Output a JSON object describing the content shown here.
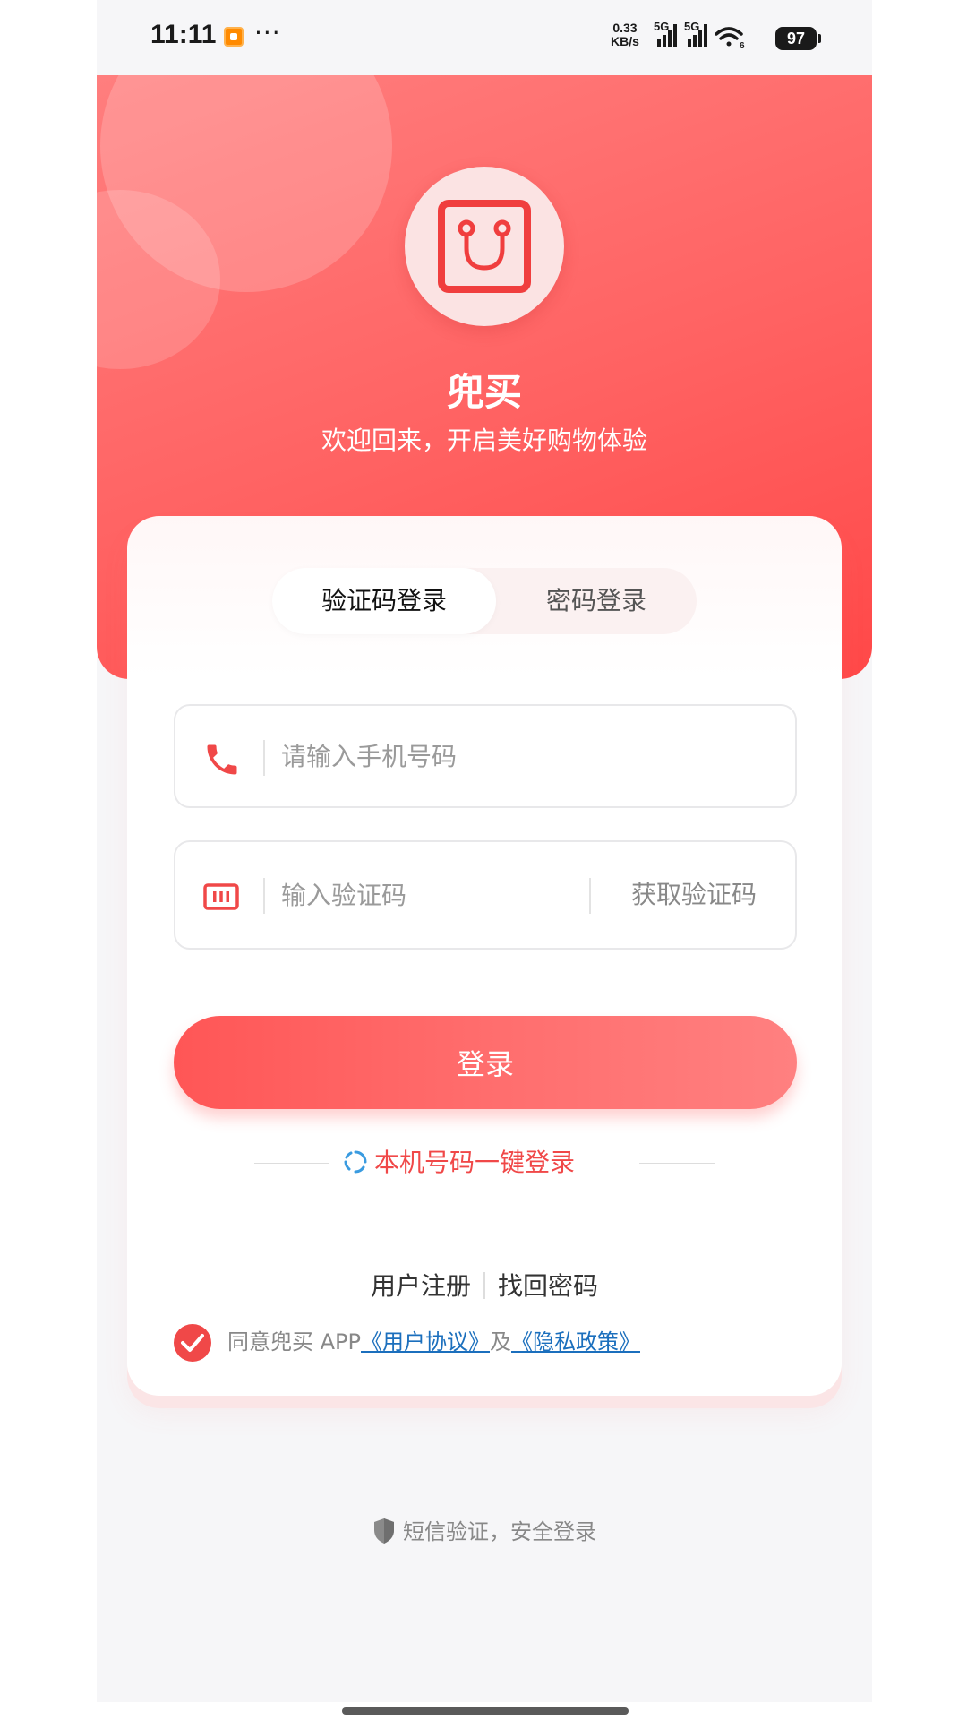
{
  "status_bar": {
    "time": "11:11",
    "more": "···",
    "speed_value": "0.33",
    "speed_unit": "KB/s",
    "network_1": "5G",
    "network_2": "5G",
    "wifi_label": "6",
    "battery": "97"
  },
  "hero": {
    "app_name": "兜买",
    "tagline": "欢迎回来，开启美好购物体验",
    "logo_icon": "shopping-bag-icon"
  },
  "tabs": [
    {
      "label": "验证码登录",
      "active": true
    },
    {
      "label": "密码登录",
      "active": false
    }
  ],
  "phone_field": {
    "icon": "phone-icon",
    "placeholder": "请输入手机号码",
    "value": ""
  },
  "code_field": {
    "icon": "keyboard-icon",
    "placeholder": "输入验证码",
    "value": "",
    "get_code_label": "获取验证码"
  },
  "login_button": {
    "label": "登录"
  },
  "one_tap_login": {
    "label": "本机号码一键登录",
    "icon": "spinner-icon"
  },
  "links": {
    "register": "用户注册",
    "forgot_password": "找回密码"
  },
  "agreement": {
    "checked": true,
    "prefix": "同意兜买 APP",
    "user_agreement": "《用户协议》",
    "and": "及",
    "privacy_policy": "《隐私政策》"
  },
  "footer": {
    "text": "短信验证，安全登录",
    "icon": "shield-icon"
  },
  "colors": {
    "primary": "#f04848",
    "hero_gradient_start": "#ff7e7e",
    "hero_gradient_end": "#ff4848",
    "link": "#1b6fbd",
    "placeholder": "#9a9a9a"
  }
}
